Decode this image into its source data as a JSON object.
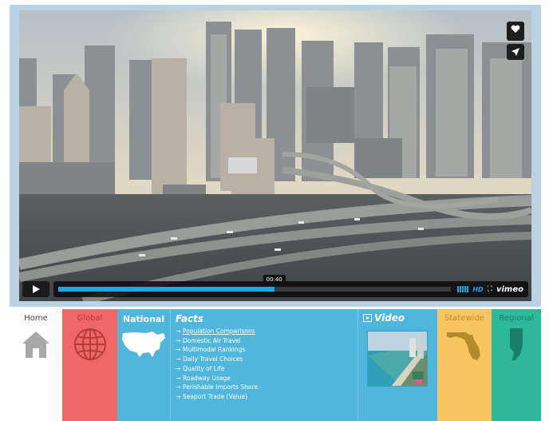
{
  "player": {
    "time": "00:40",
    "progress_fraction": 0.55,
    "loaded_fraction": 0.42,
    "hd_label": "HD",
    "brand": "vimeo"
  },
  "nav": {
    "home": "Home",
    "global": "Global",
    "national": "National",
    "facts_title": "Facts",
    "facts": [
      "Population Comparisons",
      "Domestic Air Travel",
      "Multimodal Rankings",
      "Daily Travel Choices",
      "Quality of Life",
      "Roadway Usage",
      "Perishable Imports Share",
      "Seaport Trade (Value)"
    ],
    "video_title": "Video",
    "statewide": "Statewide",
    "regional": "Regional"
  },
  "colors": {
    "accent": "#1aa8e8",
    "global": "#ee6868",
    "national": "#50b6dc",
    "statewide": "#f8c660",
    "regional": "#2db89a"
  },
  "icons": {
    "play": "play-icon",
    "like": "heart-icon",
    "share": "send-icon",
    "fullscreen": "fullscreen-icon",
    "home": "house-icon",
    "global": "globe-icon",
    "national": "usa-map-icon",
    "video": "video-icon",
    "statewide": "florida-map-icon",
    "regional": "region-map-icon"
  }
}
